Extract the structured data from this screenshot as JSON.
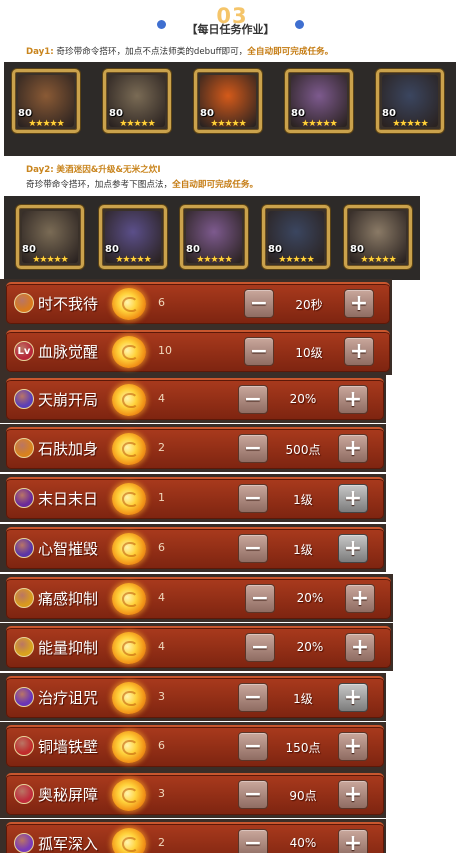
{
  "header": {
    "section_number": "03",
    "title": "【每日任务作业】"
  },
  "day1": {
    "label": "Day1:",
    "text_plain": "奇珍带命令搭环，加点不点法师类的debuff即可，",
    "text_highlight": "全自动即可完成任务。",
    "heroes": [
      {
        "name": "raccoon-icon",
        "level": "80",
        "stars": "★★★★★",
        "color": "#8a5a35"
      },
      {
        "name": "bear-icon",
        "level": "80",
        "stars": "★★★★★",
        "color": "#7a6b55"
      },
      {
        "name": "phoenix-icon",
        "level": "80",
        "stars": "★★★★★",
        "color": "#d45a1a"
      },
      {
        "name": "dancer-icon",
        "level": "80",
        "stars": "★★★★★",
        "color": "#7d5a8e"
      },
      {
        "name": "crow-icon",
        "level": "80",
        "stars": "★★★★★",
        "color": "#3b4660"
      }
    ]
  },
  "day2": {
    "label": "Day2:",
    "subtitle": "美酒迷因&升级&无米之炊Ⅰ",
    "text_plain": "奇珍带命令搭环，加点参考下图点法，",
    "text_highlight": "全自动即可完成任务。",
    "heroes": [
      {
        "name": "bear-icon",
        "level": "80",
        "stars": "★★★★★",
        "color": "#7a6b55"
      },
      {
        "name": "mage-icon",
        "level": "80",
        "stars": "★★★★★",
        "color": "#5b4f8a"
      },
      {
        "name": "dancer-icon",
        "level": "80",
        "stars": "★★★★★",
        "color": "#7d5a8e"
      },
      {
        "name": "crow-icon",
        "level": "80",
        "stars": "★★★★★",
        "color": "#3b4660"
      },
      {
        "name": "panda-icon",
        "level": "80",
        "stars": "★★★★★",
        "color": "#8a7a66"
      }
    ]
  },
  "talents": [
    {
      "name": "时不我待",
      "cost": "6",
      "value": "20秒",
      "icon": "hourglass-icon",
      "icon_color": "#d97a1e",
      "plus_gray": false
    },
    {
      "name": "血脉觉醒",
      "cost": "10",
      "value": "10级",
      "icon": "bloodline-icon",
      "icon_color": "#b8283a",
      "icon_text": "Lv",
      "plus_gray": false
    },
    {
      "name": "天崩开局",
      "cost": "4",
      "value": "20%",
      "icon": "meteor-icon",
      "icon_color": "#5b3fb8",
      "plus_gray": false
    },
    {
      "name": "石肤加身",
      "cost": "2",
      "value": "500点",
      "icon": "stone-skin-icon",
      "icon_color": "#d9821e",
      "plus_gray": false
    },
    {
      "name": "末日末日",
      "cost": "1",
      "value": "1级",
      "icon": "doom-icon",
      "icon_color": "#6a2a9a",
      "plus_gray": true
    },
    {
      "name": "心智摧毁",
      "cost": "6",
      "value": "1级",
      "icon": "mind-break-icon",
      "icon_color": "#5a35a8",
      "plus_gray": true
    },
    {
      "name": "痛感抑制",
      "cost": "4",
      "value": "20%",
      "icon": "pain-suppress-icon",
      "icon_color": "#d99a1e",
      "plus_gray": false
    },
    {
      "name": "能量抑制",
      "cost": "4",
      "value": "20%",
      "icon": "energy-suppress-icon",
      "icon_color": "#d9a21e",
      "plus_gray": false
    },
    {
      "name": "治疗诅咒",
      "cost": "3",
      "value": "1级",
      "icon": "heal-curse-icon",
      "icon_color": "#6a35b8",
      "plus_gray": true
    },
    {
      "name": "铜墙铁壁",
      "cost": "6",
      "value": "150点",
      "icon": "iron-wall-icon",
      "icon_color": "#c02c2c",
      "plus_gray": false
    },
    {
      "name": "奥秘屏障",
      "cost": "3",
      "value": "90点",
      "icon": "arcane-barrier-icon",
      "icon_color": "#c02c3c",
      "plus_gray": false
    },
    {
      "name": "孤军深入",
      "cost": "2",
      "value": "40%",
      "icon": "lone-army-icon",
      "icon_color": "#7a3ab8",
      "plus_gray": false
    }
  ],
  "controls": {
    "minus_label": "−",
    "plus_label": "+"
  }
}
